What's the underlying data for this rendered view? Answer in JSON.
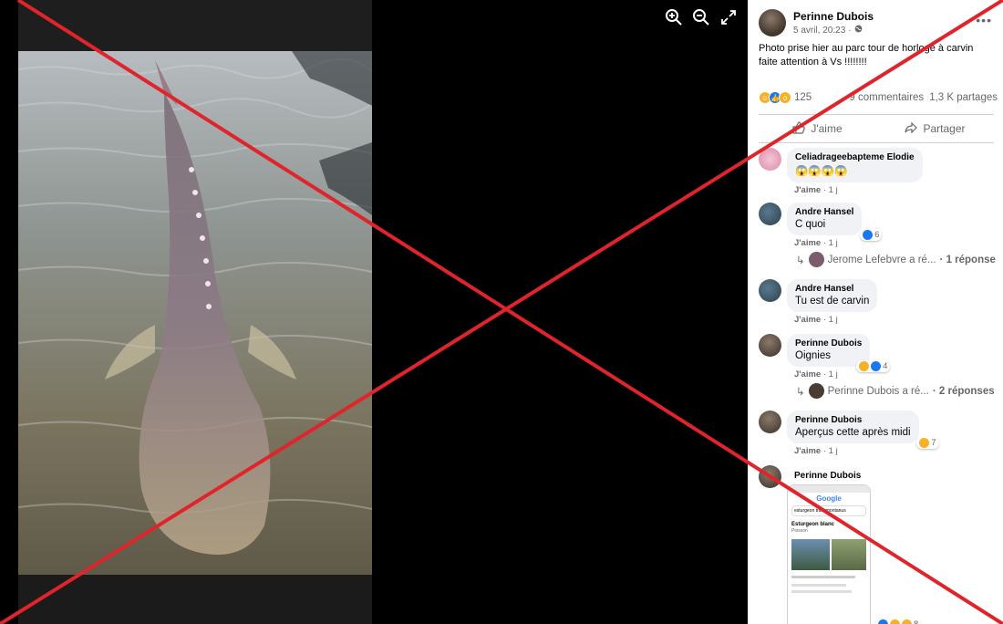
{
  "viewer": {
    "zoom_in_label": "",
    "zoom_out_label": "",
    "fullscreen_label": ""
  },
  "post": {
    "author": "Perinne Dubois",
    "date": "5 avril, 20:23",
    "privacy_icon": "globe-icon",
    "text_line1": "Photo prise hier au parc tour de horloge à carvin",
    "text_line2": "faite attention à Vs !!!!!!!!",
    "reactions_count": "125",
    "comments_count": "9 commentaires",
    "shares_count": "1,3 K partages",
    "like_label": "J'aime",
    "share_label": "Partager"
  },
  "comments": [
    {
      "name": "Celiadrageebapteme Elodie",
      "text": "😱😱😱😱",
      "like": "J'aime",
      "time": "1 j",
      "reacts": ""
    },
    {
      "name": "Andre Hansel",
      "text": "C quoi",
      "like": "J'aime",
      "time": "1 j",
      "reacts": "6",
      "reply": {
        "text": "Jerome Lefebvre a ré...",
        "count": "· 1 réponse"
      }
    },
    {
      "name": "Andre Hansel",
      "text": "Tu est de carvin",
      "like": "J'aime",
      "time": "1 j",
      "reacts": ""
    },
    {
      "name": "Perinne Dubois",
      "text": "Oignies",
      "like": "J'aime",
      "time": "1 j",
      "reacts": "4",
      "reply": {
        "text": "Perinne Dubois a ré...",
        "count": "· 2 réponses"
      }
    },
    {
      "name": "Perinne Dubois",
      "text": "Aperçus cette après midi",
      "like": "J'aime",
      "time": "1 j",
      "reacts": "7"
    },
    {
      "name": "Perinne Dubois",
      "text": "",
      "reacts": "8"
    }
  ],
  "thumbnail": {
    "brand": "Google",
    "query": "esturgeon transmontanus",
    "card_title": "Esturgeon blanc",
    "card_subtitle": "Poisson"
  },
  "colors": {
    "cross": "#e0242c",
    "like_blue": "#1877f2",
    "haha_yellow": "#f7b125"
  }
}
